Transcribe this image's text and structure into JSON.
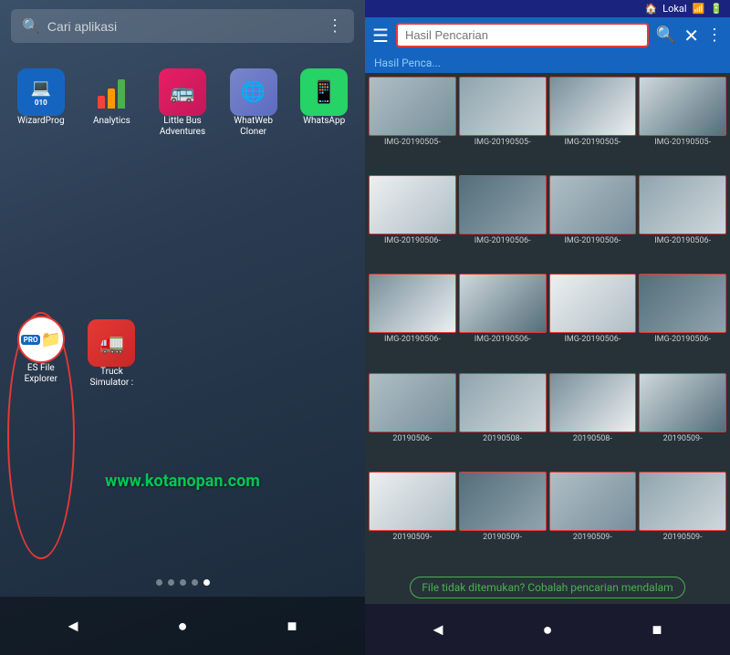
{
  "left": {
    "search_placeholder": "Cari aplikasi",
    "apps": [
      {
        "id": "wizardprog",
        "label": "WizardProg",
        "icon_type": "wizard"
      },
      {
        "id": "analytics",
        "label": "Analytics",
        "icon_type": "analytics"
      },
      {
        "id": "littlebus",
        "label": "Little Bus Adventures",
        "icon_type": "littlebus"
      },
      {
        "id": "whatweb",
        "label": "WhatWeb Cloner",
        "icon_type": "whatweb"
      },
      {
        "id": "whatsapp",
        "label": "WhatsApp",
        "icon_type": "whatsapp"
      },
      {
        "id": "esfile",
        "label": "ES File Explorer",
        "icon_type": "esfile"
      },
      {
        "id": "truck",
        "label": "Truck Simulator :",
        "icon_type": "truck"
      }
    ],
    "watermark": "www.kotanopan.com",
    "dots": [
      false,
      false,
      false,
      false,
      true
    ],
    "nav": [
      "◄",
      "●",
      "■"
    ]
  },
  "right": {
    "status": {
      "location": "Lokal",
      "icons": [
        "🏠",
        "📶",
        "🔋"
      ]
    },
    "header": {
      "menu_icon": "☰",
      "title": "Hasil Pencarian",
      "search_icon": "🔍",
      "close_icon": "✕",
      "dots_icon": "⋮"
    },
    "hasil_label": "Hasil Penca...",
    "photos": [
      {
        "label": "IMG-20190505-"
      },
      {
        "label": "IMG-20190505-"
      },
      {
        "label": "IMG-20190505-"
      },
      {
        "label": "IMG-20190505-"
      },
      {
        "label": "IMG-20190506-"
      },
      {
        "label": "IMG-20190506-"
      },
      {
        "label": "IMG-20190506-"
      },
      {
        "label": "IMG-20190506-"
      },
      {
        "label": "IMG-20190506-"
      },
      {
        "label": "IMG-20190506-"
      },
      {
        "label": "IMG-20190506-"
      },
      {
        "label": "IMG-20190506-"
      },
      {
        "label": "20190506-"
      },
      {
        "label": "20190508-"
      },
      {
        "label": "20190508-"
      },
      {
        "label": "20190509-"
      },
      {
        "label": "20190509-"
      },
      {
        "label": "20190509-"
      },
      {
        "label": "20190509-"
      },
      {
        "label": "20190509-"
      }
    ],
    "hint": "File tidak ditemukan? Cobalah pencarian mendalam",
    "nav": [
      "◄",
      "●",
      "■"
    ]
  }
}
